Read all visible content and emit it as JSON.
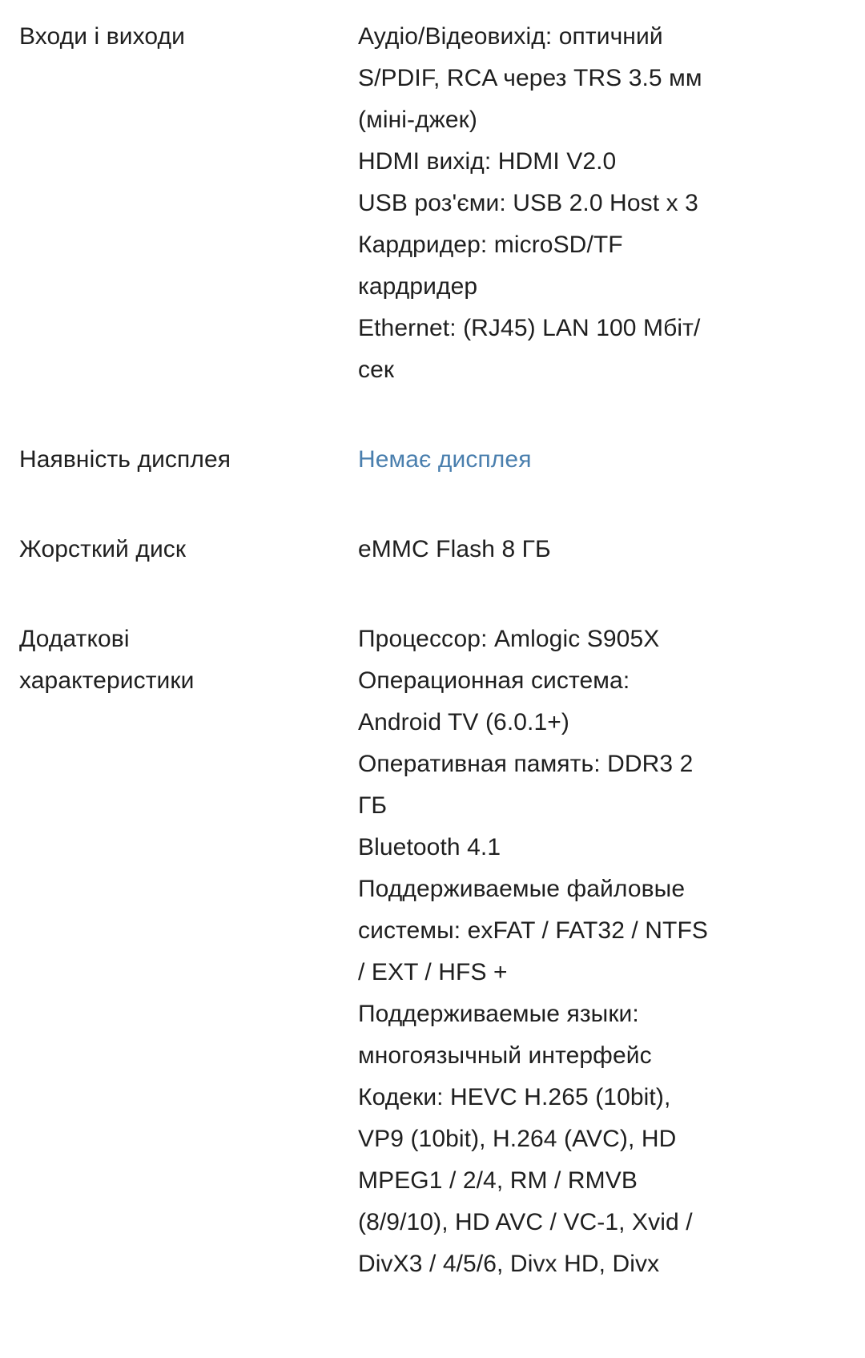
{
  "page": {
    "type": "product-specification-table",
    "language": "uk-ru",
    "background_color": "#ffffff",
    "text_color": "#1f1f1f",
    "link_color": "#4a7fae"
  },
  "rows": [
    {
      "id": "inputs-outputs",
      "label": "Входи і виходи",
      "label_lines": [
        "Входи і виходи"
      ],
      "is_link": false,
      "value_lines": [
        "Аудіо/Відеовихід: оптичний",
        "S/PDIF, RCA через TRS 3.5 мм",
        "(міні-джек)",
        "HDMI вихід: HDMI V2.0",
        "USB роз'єми: USB 2.0 Host x 3",
        "Кардридер: microSD/TF",
        "кардридер",
        "Ethernet: (RJ45) LAN 100 Мбіт/",
        "сек"
      ]
    },
    {
      "id": "display-presence",
      "label": "Наявність дисплея",
      "label_lines": [
        "Наявність дисплея"
      ],
      "is_link": true,
      "value_lines": [
        "Немає дисплея"
      ]
    },
    {
      "id": "hard-drive",
      "label": "Жорсткий диск",
      "label_lines": [
        "Жорсткий диск"
      ],
      "is_link": false,
      "value_lines": [
        "eMMC Flash 8 ГБ"
      ]
    },
    {
      "id": "additional-characteristics",
      "label": "Додаткові характеристики",
      "label_lines": [
        "Додаткові",
        "характеристики"
      ],
      "is_link": false,
      "value_lines": [
        "Процессор: Amlogic S905X",
        "Операционная система:",
        "Android TV (6.0.1+)",
        "Оперативная память: DDR3 2",
        "ГБ",
        "Bluetooth 4.1",
        "Поддерживаемые файловые",
        "системы: exFAT / FAT32 / NTFS",
        "/ EXT / HFS +",
        "Поддерживаемые языки:",
        "многоязычный интерфейс",
        "Кодеки: HEVC H.265 (10bit),",
        "VP9 (10bit), H.264 (AVC), HD",
        "MPEG1 / 2/4, RM / RMVB",
        "(8/9/10), HD AVC / VC-1, Xvid /",
        "DivX3 / 4/5/6, Divx HD, Divx"
      ]
    }
  ]
}
